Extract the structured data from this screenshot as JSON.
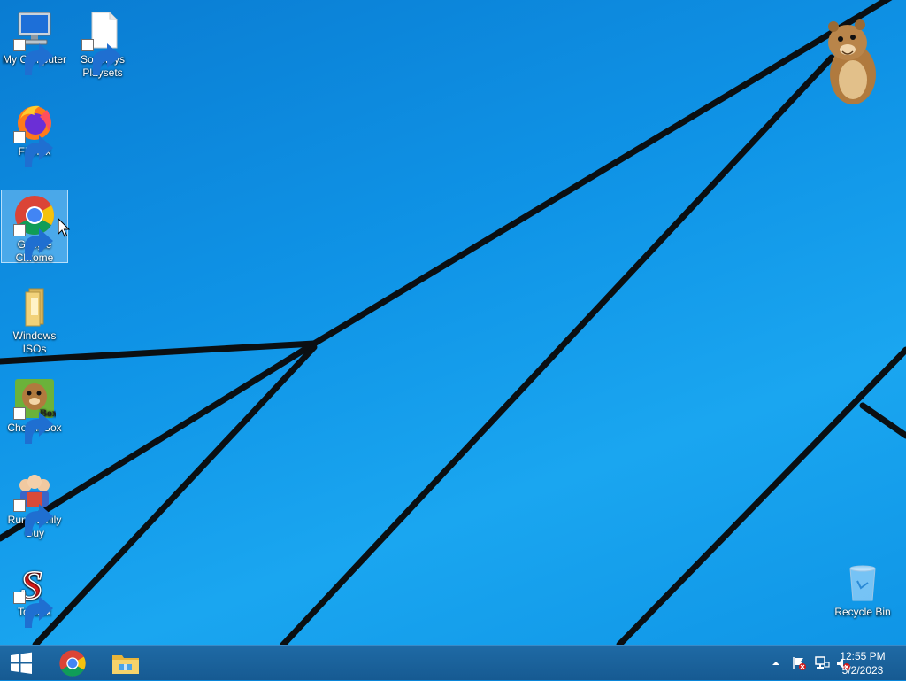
{
  "desktop": {
    "icons": [
      {
        "label": "My Computer",
        "icon": "computer-icon",
        "shortcut": true
      },
      {
        "label": "Souptoys Playsets",
        "icon": "blank-file-icon",
        "shortcut": true
      },
      {
        "label": "Firefox",
        "icon": "firefox-icon",
        "shortcut": true
      },
      {
        "label": "Google Chrome",
        "icon": "chrome-icon",
        "shortcut": true,
        "selected": true
      },
      {
        "label": "Windows ISOs",
        "icon": "folder-icon",
        "shortcut": false
      },
      {
        "label": "ChomikBox",
        "icon": "chomikbox-icon",
        "shortcut": true,
        "badge_text": "Box"
      },
      {
        "label": "Run Family Guy",
        "icon": "family-guy-icon",
        "shortcut": true
      },
      {
        "label": "Toybox",
        "icon": "toybox-icon",
        "shortcut": true,
        "glyph": "S"
      },
      {
        "label": "Recycle Bin",
        "icon": "recycle-bin-icon",
        "shortcut": false
      }
    ]
  },
  "taskbar": {
    "pinned": [
      {
        "name": "start-button",
        "icon": "windows-logo-icon"
      },
      {
        "name": "chrome",
        "icon": "chrome-icon"
      },
      {
        "name": "file-explorer",
        "icon": "file-explorer-icon"
      }
    ],
    "tray": {
      "icons": [
        "show-hidden-icons-arrow",
        "action-center-flag-icon",
        "network-icon",
        "volume-muted-icon"
      ]
    },
    "clock": {
      "time": "12:55 PM",
      "date": "5/2/2023"
    }
  },
  "colors": {
    "wallpaper_blue": "#0f93e6",
    "taskbar": "#1a5f98",
    "selection": "#bee1ff"
  }
}
